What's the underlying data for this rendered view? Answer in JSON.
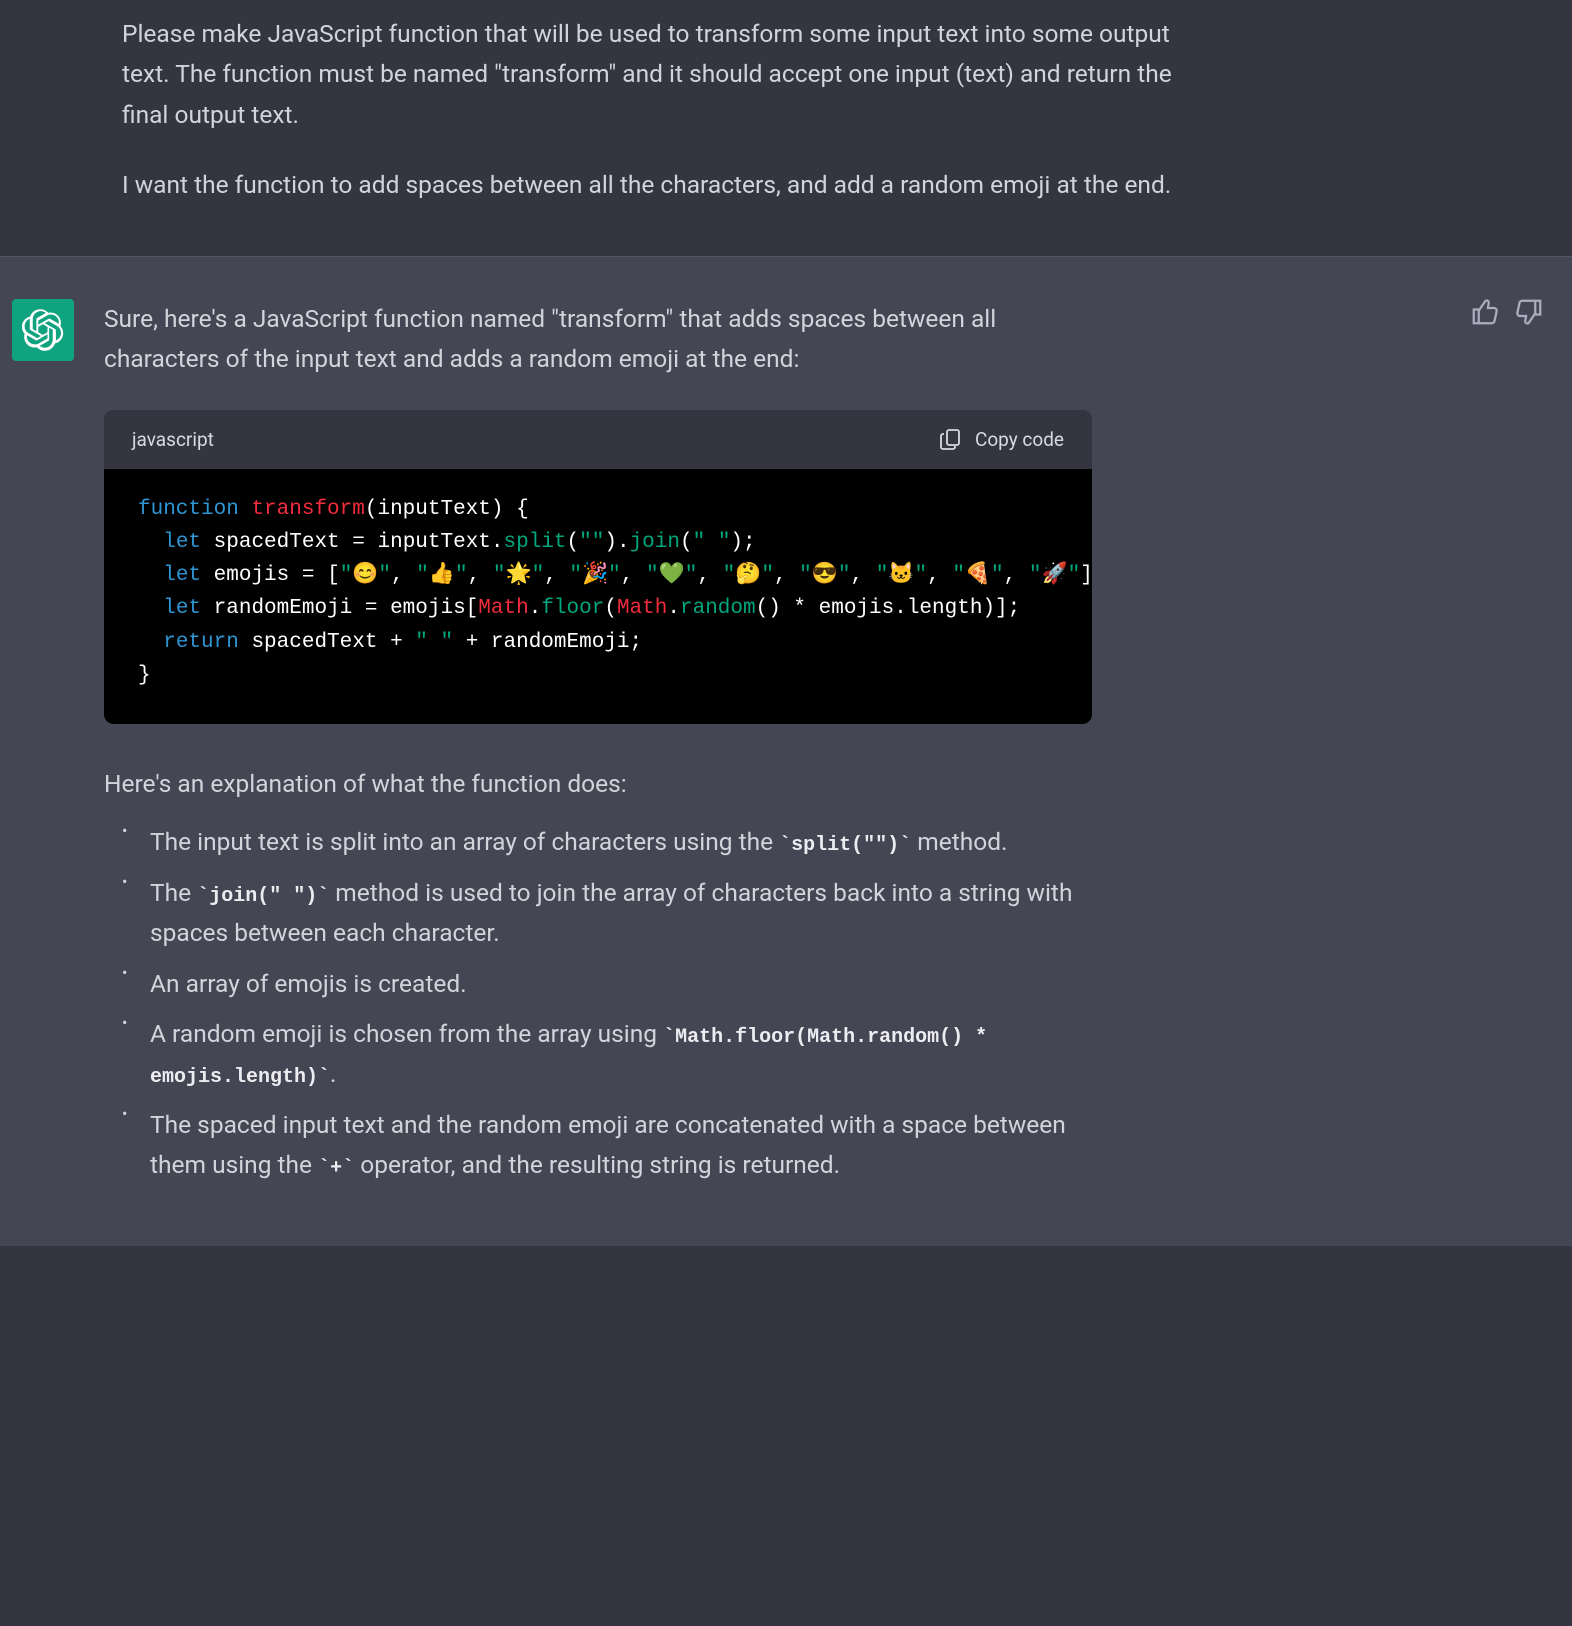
{
  "user": {
    "p1": "Please make JavaScript function that will be used to transform some input text into some output text. The function must be named \"transform\" and it should accept one input (text) and return the final output text.",
    "p2": "I want the function to add spaces between all the characters, and add a random emoji at the end."
  },
  "assistant": {
    "intro": "Sure, here's a JavaScript function named \"transform\" that adds spaces between all characters of the input text and adds a random emoji at the end:",
    "code": {
      "lang": "javascript",
      "copy_label": "Copy code",
      "kw_function": "function",
      "fn_name": "transform",
      "param": "inputText",
      "kw_let1": "let",
      "var_spaced": "spacedText",
      "eq": " = ",
      "inputText_ref": "inputText",
      "m_split": "split",
      "str_empty": "\"\"",
      "m_join": "join",
      "str_space": "\" \"",
      "kw_let2": "let",
      "var_emojis": "emojis",
      "em_open": " = [",
      "emo0": "\"😊\"",
      "emo1": "\"👍\"",
      "emo2": "\"🌟\"",
      "emo3": "\"🎉\"",
      "emo4": "\"💚\"",
      "emo5": "\"🤔\"",
      "emo6": "\"😎\"",
      "emo7": "\"🐱\"",
      "emo8": "\"🍕\"",
      "emo9": "\"🚀\"",
      "em_close": "];",
      "kw_let3": "let",
      "var_rand": "randomEmoji",
      "emojis_idx": " = emojis[",
      "cls_math1": "Math",
      "m_floor": "floor",
      "cls_math2": "Math",
      "m_random": "random",
      "times_len": "() * emojis.length)];",
      "kw_return": "return",
      "ret_body": " spacedText + ",
      "str_space2": "\" \"",
      "ret_tail": " + randomEmoji;"
    },
    "explain_intro": "Here's an explanation of what the function does:",
    "bullets": {
      "b1_a": "The input text is split into an array of characters using the ",
      "b1_code": "`split(\"\")`",
      "b1_b": " method.",
      "b2_a": "The ",
      "b2_code": "`join(\" \")`",
      "b2_b": " method is used to join the array of characters back into a string with spaces between each character.",
      "b3": "An array of emojis is created.",
      "b4_a": "A random emoji is chosen from the array using ",
      "b4_code": "`Math.floor(Math.random() * emojis.length)`",
      "b4_b": ".",
      "b5_a": "The spaced input text and the random emoji are concatenated with a space between them using the ",
      "b5_code": "`+`",
      "b5_b": " operator, and the resulting string is returned."
    }
  }
}
